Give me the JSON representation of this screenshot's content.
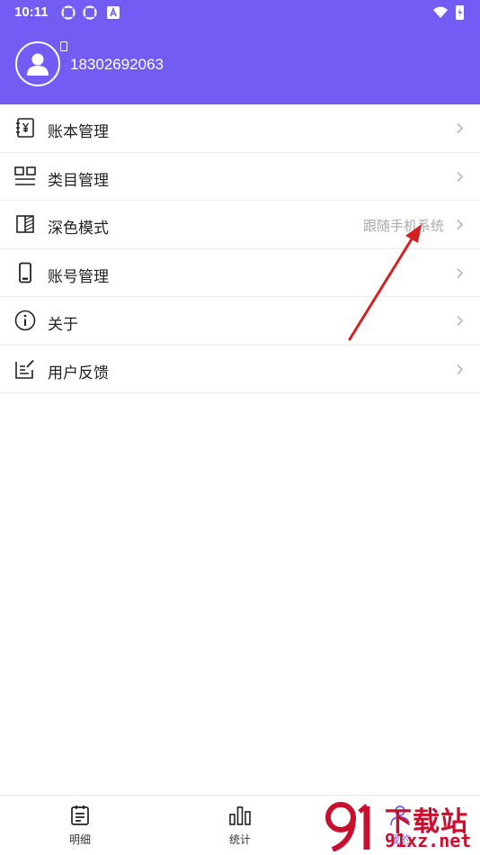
{
  "status_bar": {
    "time": "10:11",
    "icons": [
      "sync-icon",
      "sync-icon",
      "font-a-icon"
    ],
    "right_icons": [
      "wifi-icon",
      "battery-charging-icon"
    ]
  },
  "profile": {
    "phone_number": "18302692063",
    "avatar_icon": "user-avatar-icon",
    "phone_badge_icon": "phone-icon"
  },
  "menu": {
    "items": [
      {
        "label": "账本管理",
        "icon": "ledger-yuan-icon",
        "value": ""
      },
      {
        "label": "类目管理",
        "icon": "category-grid-icon",
        "value": ""
      },
      {
        "label": "深色模式",
        "icon": "dark-mode-icon",
        "value": "跟随手机系统"
      },
      {
        "label": "账号管理",
        "icon": "phone-icon",
        "value": ""
      },
      {
        "label": "关于",
        "icon": "info-icon",
        "value": ""
      },
      {
        "label": "用户反馈",
        "icon": "feedback-icon",
        "value": ""
      }
    ]
  },
  "bottom_nav": {
    "items": [
      {
        "label": "明细",
        "icon": "list-detail-icon"
      },
      {
        "label": "统计",
        "icon": "bar-chart-icon"
      },
      {
        "label": "我的",
        "icon": "person-icon"
      }
    ]
  },
  "watermark": {
    "line1": "下载站",
    "line2": "91xz.net"
  },
  "colors": {
    "header": "#735cf3",
    "annotation_arrow": "#d42020",
    "watermark": "#c8102e"
  }
}
